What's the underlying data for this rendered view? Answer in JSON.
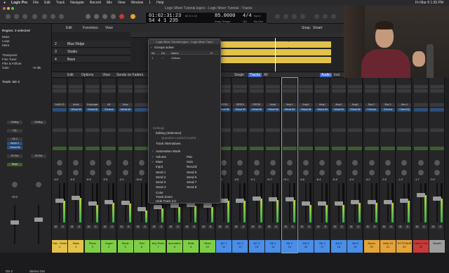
{
  "menubar": {
    "apple": "",
    "app": "Logic Pro",
    "items": [
      "File",
      "Edit",
      "Track",
      "Navigate",
      "Record",
      "Mix",
      "View",
      "Window",
      "1",
      "Help"
    ],
    "clock": "Fri Mar 8  1:35 PM"
  },
  "window": {
    "title": "Logic Mixer Tutorial.logicx - Logic Mixer Tutorial - Tracks"
  },
  "lcd": {
    "time": "01:02:31:23",
    "bars": "54  4  1  235",
    "time_sub1": "62  3  1  13",
    "time_sub2": "",
    "tempo": "85.0000",
    "tempo_label": "Keep Tempo",
    "sig": "4/4",
    "sig_div": "/16",
    "in": "No In",
    "out": "No Out"
  },
  "inspector": {
    "region": "Region: 3 selected",
    "mute_label": "Mute:",
    "loop_label": "Loop:",
    "more": "More",
    "transpose": "Transpose:",
    "fine_tune": "Fine Tune:",
    "flex_follow": "Flex & Follow:",
    "gain": "Gain:",
    "gain_val": "+0 dB",
    "track": "Track: Gtr 2",
    "setting": "Setting",
    "eq": "EQ",
    "input": "Input",
    "input_val": "Gtr 2",
    "audio_fx": "Audio FX",
    "fx1": "Amps 1",
    "fx2": "Virtual Mi",
    "sends": "Sends",
    "output": "St Out",
    "group": "Group",
    "automation": "Read",
    "volume": "+0.0",
    "pan": "0.0",
    "bottom_left": "Gtr 2",
    "bottom_right": "Stereo Out"
  },
  "tracks": {
    "items": [
      {
        "num": "2",
        "name": "Blue Ridge"
      },
      {
        "num": "3",
        "name": "Studio"
      },
      {
        "num": "4",
        "name": "Bass"
      }
    ],
    "toolbar": [
      "Edit",
      "Functions",
      "View"
    ],
    "snap_label": "Snap:",
    "snap_value": "Smart"
  },
  "mixer_toolbar": {
    "edit": "Edit",
    "options": "Options",
    "view": "View",
    "sends": "Sends on Faders",
    "single": "Single",
    "tracks": "Tracks",
    "all": "All",
    "audio": "Audio",
    "inst": "Inst"
  },
  "popup": {
    "title": "Logic Mixer Tutorial.logicx - Logic Mixer Tutori",
    "groups_active": "Groups active",
    "col_nr": "Nr.",
    "col_on": "On",
    "col_name": "Name",
    "col_h": "H",
    "group1_nr": "1",
    "group1_name": "Guitars",
    "settings_label": "Settings",
    "editing": "Editing (Selection)",
    "quantize": "Quantize Locked (Audio)",
    "track_alt": "Track Alternatives",
    "automation_mode": "Automation Mode",
    "volume": "Volume",
    "pan": "Pan",
    "mute": "Mute",
    "solo": "Solo",
    "input": "Input",
    "record": "Record",
    "send1": "Send 1",
    "send2": "Send 2",
    "send3": "Send 3",
    "send4": "Send 4",
    "send5": "Send 5",
    "send6": "Send 6",
    "send7": "Send 7",
    "send8": "Send 8",
    "color": "Color",
    "track_zoom": "Track Zoom",
    "hide_track": "Hide Track (H)"
  },
  "strips": [
    {
      "name": "Cab.. Sente",
      "num": "1",
      "color": "#e3c24a",
      "input": "Sa28-22",
      "fx": "",
      "vol": "-3.0",
      "level": 0.55
    },
    {
      "name": "Bass",
      "num": "2",
      "color": "#e3c24a",
      "input": "Anslo",
      "fx": "Virtual Mi",
      "vol": "-0.3",
      "level": 0.62
    },
    {
      "name": "Piano",
      "num": "3",
      "color": "#7fcf46",
      "input": "Keyscape",
      "fx": "Virtual Mi",
      "vol": "-6.5",
      "level": 0.45
    },
    {
      "name": "Organ",
      "num": "4",
      "color": "#7fcf46",
      "input": "Alt",
      "fx": "Chroma",
      "vol": "-3.5",
      "level": 0.5
    },
    {
      "name": "Wurlz",
      "num": "5",
      "color": "#7fcf46",
      "input": "Keys",
      "fx": "Virtual Mi",
      "vol": "-2.4",
      "level": 0.48
    },
    {
      "name": "Pad",
      "num": "6",
      "color": "#7fcf46",
      "input": "",
      "fx": "",
      "vol": "-16.5",
      "level": 0.3
    },
    {
      "name": "Airy Picks",
      "num": "7",
      "color": "#7fcf46",
      "input": "",
      "fx": "",
      "vol": "-10.3",
      "level": 0.35
    },
    {
      "name": "Accordion",
      "num": "8",
      "color": "#7fcf46",
      "input": "",
      "fx": "",
      "vol": "-3.5",
      "level": 0.4
    },
    {
      "name": "Bells",
      "num": "9",
      "color": "#7fcf46",
      "input": "",
      "fx": "",
      "vol": "-7.2",
      "level": 0.42
    },
    {
      "name": "Vibes",
      "num": "10",
      "color": "#7fcf46",
      "input": "REDDI",
      "fx": "Virtual Mi",
      "vol": "-8.1",
      "level": 0.4
    },
    {
      "name": "AC 1",
      "num": "11",
      "color": "#4a8ee8",
      "input": "REDDI",
      "fx": "Virtual Mi",
      "vol": "-3.0",
      "level": 0.55
    },
    {
      "name": "AC 2",
      "num": "12",
      "color": "#4a8ee8",
      "input": "REDDI",
      "fx": "Virtual Mi",
      "vol": "-3.0",
      "level": 0.55
    },
    {
      "name": "AC 3",
      "num": "13",
      "color": "#4a8ee8",
      "input": "REDDI",
      "fx": "Virtual Mi",
      "vol": "-0.1",
      "level": 0.6
    },
    {
      "name": "Gtr 1",
      "num": "14",
      "color": "#4a8ee8",
      "input": "Amp1",
      "fx": "Virtual Mi",
      "vol": "+0.7",
      "level": 0.58
    },
    {
      "name": "Gtr 2",
      "num": "15",
      "color": "#4a8ee8",
      "input": "Amp1",
      "fx": "Virtual Mi",
      "vol": "+0.1",
      "level": 0.58
    },
    {
      "name": "Gtr 3",
      "num": "16",
      "color": "#4a8ee8",
      "input": "Amp1",
      "fx": "Virtual Mi",
      "vol": "-5.8",
      "level": 0.45
    },
    {
      "name": "Gtr 4",
      "num": "17",
      "color": "#4a8ee8",
      "input": "Amp1",
      "fx": "Virtual Mi",
      "vol": "-6.4",
      "level": 0.45
    },
    {
      "name": "Gtr 5",
      "num": "18",
      "color": "#4a8ee8",
      "input": "Amp1",
      "fx": "Virtual Mi",
      "vol": "-5.8",
      "level": 0.45
    },
    {
      "name": "Gtr 6",
      "num": "19",
      "color": "#4a8ee8",
      "input": "Amp1",
      "fx": "Virtual Mi",
      "vol": "-4.4",
      "level": 0.5
    },
    {
      "name": "Boom",
      "num": "20",
      "color": "#e3a43a",
      "input": "Bus 2",
      "fx": "Chroma",
      "vol": "-4.2",
      "level": 0.5
    },
    {
      "name": "Amb 15",
      "num": "21",
      "color": "#e3a43a",
      "input": "Bus 3",
      "fx": "Chroma",
      "vol": "-3.5",
      "level": 0.5
    },
    {
      "name": "SYTS BUS",
      "num": "22",
      "color": "#e3a43a",
      "input": "Bus 4",
      "fx": "Chan EQ",
      "vol": "-1.2",
      "level": 0.55
    },
    {
      "name": "Stereo Out",
      "num": "23",
      "color": "#c93a3a",
      "input": "",
      "fx": "",
      "vol": "-1.7",
      "level": 0.7
    },
    {
      "name": "Master",
      "num": "",
      "color": "#9e9e9e",
      "input": "",
      "fx": "",
      "vol": "0.0",
      "level": 0.6
    }
  ]
}
